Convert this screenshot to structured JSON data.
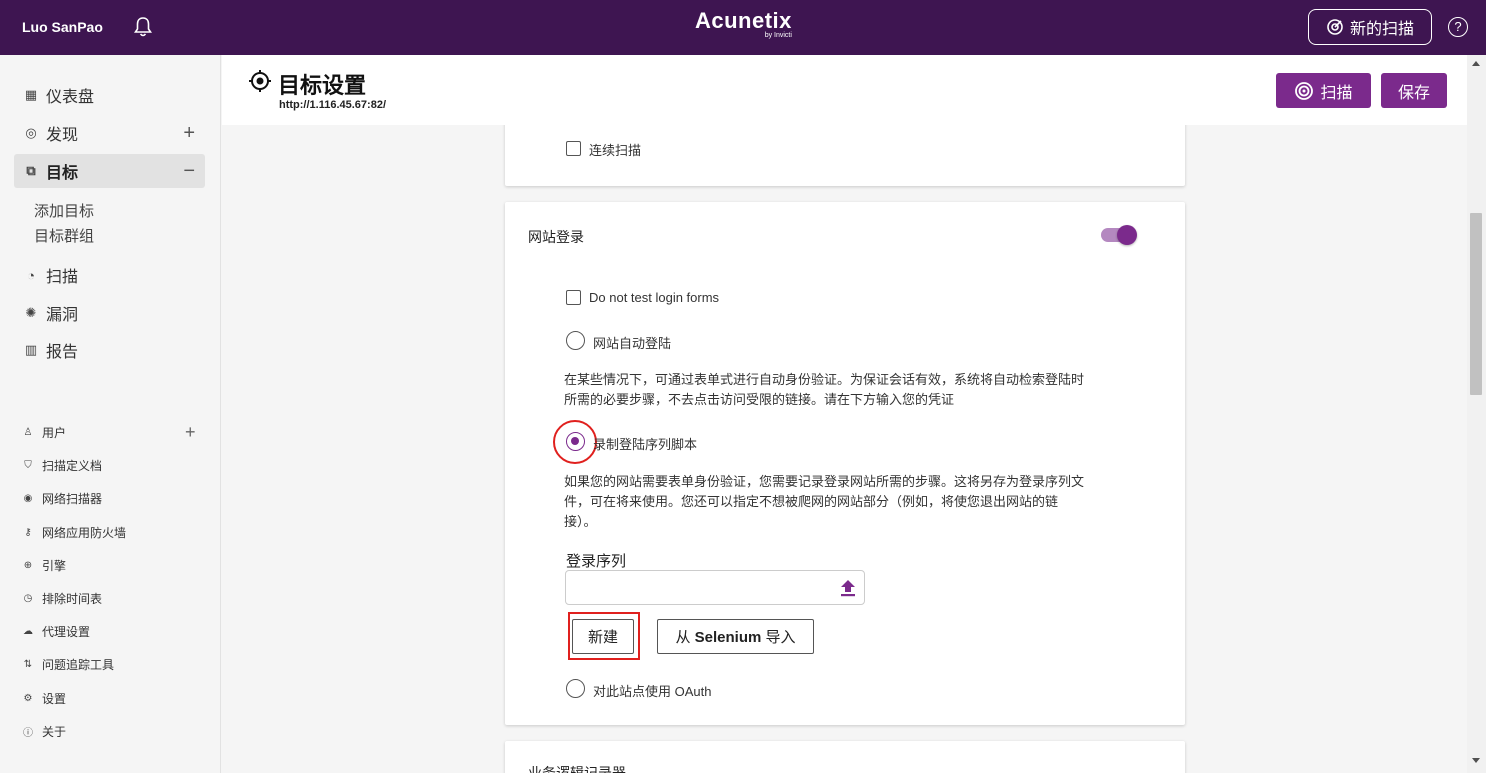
{
  "topbar": {
    "user_name": "Luo SanPao",
    "brand": "Acunetix",
    "brand_sub": "by Invicti",
    "new_scan_label": "新的扫描",
    "help_glyph": "?"
  },
  "sidebar": {
    "items": [
      {
        "label": "仪表盘",
        "icon": "dashboard-icon"
      },
      {
        "label": "发现",
        "icon": "discovery-icon",
        "action": "+"
      },
      {
        "label": "目标",
        "icon": "targets-icon",
        "action": "−"
      },
      {
        "label": "扫描",
        "icon": "scan-icon"
      },
      {
        "label": "漏洞",
        "icon": "bug-icon"
      },
      {
        "label": "报告",
        "icon": "chart-icon"
      }
    ],
    "sub_items": [
      "添加目标",
      "目标群组"
    ],
    "small_items": [
      "用户",
      "扫描定义档",
      "网络扫描器",
      "网络应用防火墙",
      "引擎",
      "排除时间表",
      "代理设置",
      "问题追踪工具",
      "设置",
      "关于"
    ],
    "users_action": "+"
  },
  "header": {
    "title": "目标设置",
    "url": "http://1.116.45.67:82/",
    "scan_label": "扫描",
    "save_label": "保存"
  },
  "card_top": {
    "continuous_scan_label": "连续扫描",
    "continuous_scan_checked": false
  },
  "login_card": {
    "title": "网站登录",
    "enabled": true,
    "do_not_test_label": "Do not test login forms",
    "auto_login_label": "网站自动登陆",
    "auto_login_desc_1": "在某些情况下，可通过表单式进行自动身份验证。为保证会话有效，系统将自动检索登陆时",
    "auto_login_desc_2": "所需的必要步骤，不去点击访问受限的链接。请在下方输入您的凭证",
    "record_label": "录制登陆序列脚本",
    "record_desc_1": "如果您的网站需要表单身份验证，您需要记录登录网站所需的步骤。这将另存为登录序列文",
    "record_desc_2": "件，可在将来使用。您还可以指定不想被爬网的网站部分（例如，将使您退出网站的链",
    "record_desc_3": "接）。",
    "sequence_label": "登录序列",
    "sequence_value": "",
    "new_label": "新建",
    "import_prefix": "从 ",
    "import_bold": "Selenium",
    "import_suffix": " 导入",
    "oauth_label": "对此站点使用 OAuth",
    "selected_option": "record"
  },
  "card_bottom": {
    "title": "业务逻辑记录器"
  },
  "colors": {
    "topbar": "#3e1551",
    "accent": "#7b2a8c",
    "highlight": "#e0201e"
  }
}
